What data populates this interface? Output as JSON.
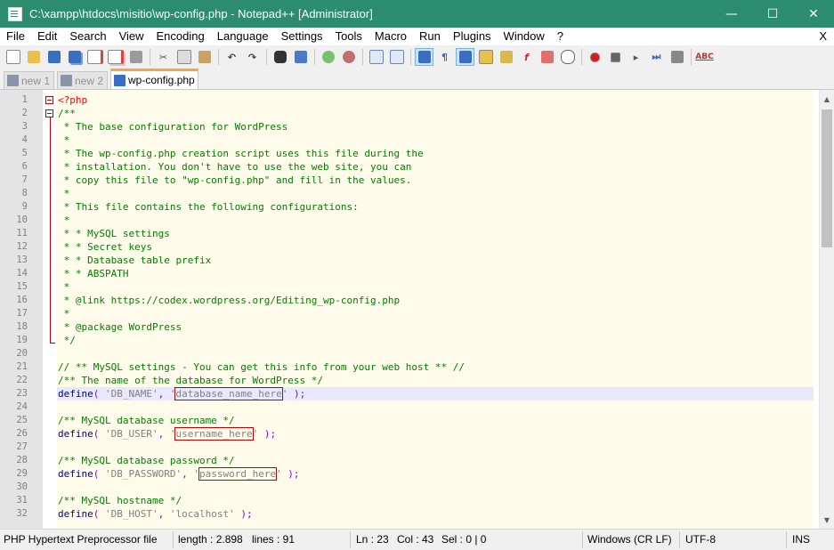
{
  "window": {
    "title": "C:\\xampp\\htdocs\\misitio\\wp-config.php - Notepad++ [Administrator]",
    "minimize": "—",
    "maximize": "☐",
    "close": "✕"
  },
  "menu": {
    "items": [
      "File",
      "Edit",
      "Search",
      "View",
      "Encoding",
      "Language",
      "Settings",
      "Tools",
      "Macro",
      "Run",
      "Plugins",
      "Window",
      "?"
    ],
    "close_doc": "X"
  },
  "toolbar": {
    "icons": [
      "new-file-icon",
      "open-file-icon",
      "save-icon",
      "save-all-icon",
      "close-icon",
      "close-all-icon",
      "print-icon",
      "cut-icon",
      "copy-icon",
      "paste-icon",
      "undo-icon",
      "redo-icon",
      "find-icon",
      "replace-icon",
      "zoom-in-icon",
      "zoom-out-icon",
      "sync-vertical-icon",
      "sync-horizontal-icon",
      "word-wrap-icon",
      "show-all-chars-icon",
      "indent-guide-icon",
      "user-language-icon",
      "doc-map-icon",
      "function-list-icon",
      "folder-workspace-icon",
      "monitor-icon",
      "record-macro-icon",
      "stop-record-icon",
      "play-macro-icon",
      "run-multiple-icon",
      "save-macro-icon",
      "spell-check-icon"
    ],
    "spellcheck_label": "ABC"
  },
  "tabs": [
    {
      "label": "new 1",
      "active": false
    },
    {
      "label": "new 2",
      "active": false
    },
    {
      "label": "wp-config.php",
      "active": true
    }
  ],
  "editor": {
    "current_line": 23,
    "lines": [
      {
        "n": "1",
        "text": "<?php"
      },
      {
        "n": "2",
        "text": "/**"
      },
      {
        "n": "3",
        "text": " * The base configuration for WordPress"
      },
      {
        "n": "4",
        "text": " *"
      },
      {
        "n": "5",
        "text": " * The wp-config.php creation script uses this file during the"
      },
      {
        "n": "6",
        "text": " * installation. You don't have to use the web site, you can"
      },
      {
        "n": "7",
        "text": " * copy this file to \"wp-config.php\" and fill in the values."
      },
      {
        "n": "8",
        "text": " *"
      },
      {
        "n": "9",
        "text": " * This file contains the following configurations:"
      },
      {
        "n": "10",
        "text": " *"
      },
      {
        "n": "11",
        "text": " * * MySQL settings"
      },
      {
        "n": "12",
        "text": " * * Secret keys"
      },
      {
        "n": "13",
        "text": " * * Database table prefix"
      },
      {
        "n": "14",
        "text": " * * ABSPATH"
      },
      {
        "n": "15",
        "text": " *"
      },
      {
        "n": "16",
        "text": " * @link https://codex.wordpress.org/Editing_wp-config.php"
      },
      {
        "n": "17",
        "text": " *"
      },
      {
        "n": "18",
        "text": " * @package WordPress"
      },
      {
        "n": "19",
        "text": " */"
      },
      {
        "n": "20",
        "text": ""
      },
      {
        "n": "21",
        "text": "// ** MySQL settings - You can get this info from your web host ** //"
      },
      {
        "n": "22",
        "text": "/** The name of the database for WordPress */"
      },
      {
        "n": "23",
        "kw": "define",
        "p1": "( ",
        "s1": "'DB_NAME'",
        "p2": ", ",
        "q1": "'",
        "val": "database_name_here",
        "q2": "'",
        "p3": " );"
      },
      {
        "n": "24",
        "text": ""
      },
      {
        "n": "25",
        "text": "/** MySQL database username */"
      },
      {
        "n": "26",
        "kw": "define",
        "p1": "( ",
        "s1": "'DB_USER'",
        "p2": ", ",
        "q1": "'",
        "val": "username_here",
        "q2": "'",
        "p3": " );"
      },
      {
        "n": "27",
        "text": ""
      },
      {
        "n": "28",
        "text": "/** MySQL database password */"
      },
      {
        "n": "29",
        "kw": "define",
        "p1": "( ",
        "s1": "'DB_PASSWORD'",
        "p2": ", ",
        "q1": "'",
        "val": "password_here",
        "q2": "'",
        "p3": " );"
      },
      {
        "n": "30",
        "text": ""
      },
      {
        "n": "31",
        "text": "/** MySQL hostname */"
      },
      {
        "n": "32",
        "kw": "define",
        "p1": "( ",
        "s1": "'DB_HOST'",
        "p2": ", ",
        "q1": "",
        "val": "'localhost'",
        "q2": "",
        "p3": " );"
      }
    ]
  },
  "status": {
    "filetype": "PHP Hypertext Preprocessor file",
    "length": "length : 2.898",
    "lines": "lines : 91",
    "ln": "Ln : 23",
    "col": "Col : 43",
    "sel": "Sel : 0 | 0",
    "eol": "Windows (CR LF)",
    "encoding": "UTF-8",
    "mode": "INS"
  },
  "colors": {
    "titlebar": "#2b8c6e",
    "comment": "#008000",
    "keyword": "#000080",
    "string": "#808080",
    "highlight_box": "#c00000",
    "active_tab_accent": "#f6a540"
  }
}
